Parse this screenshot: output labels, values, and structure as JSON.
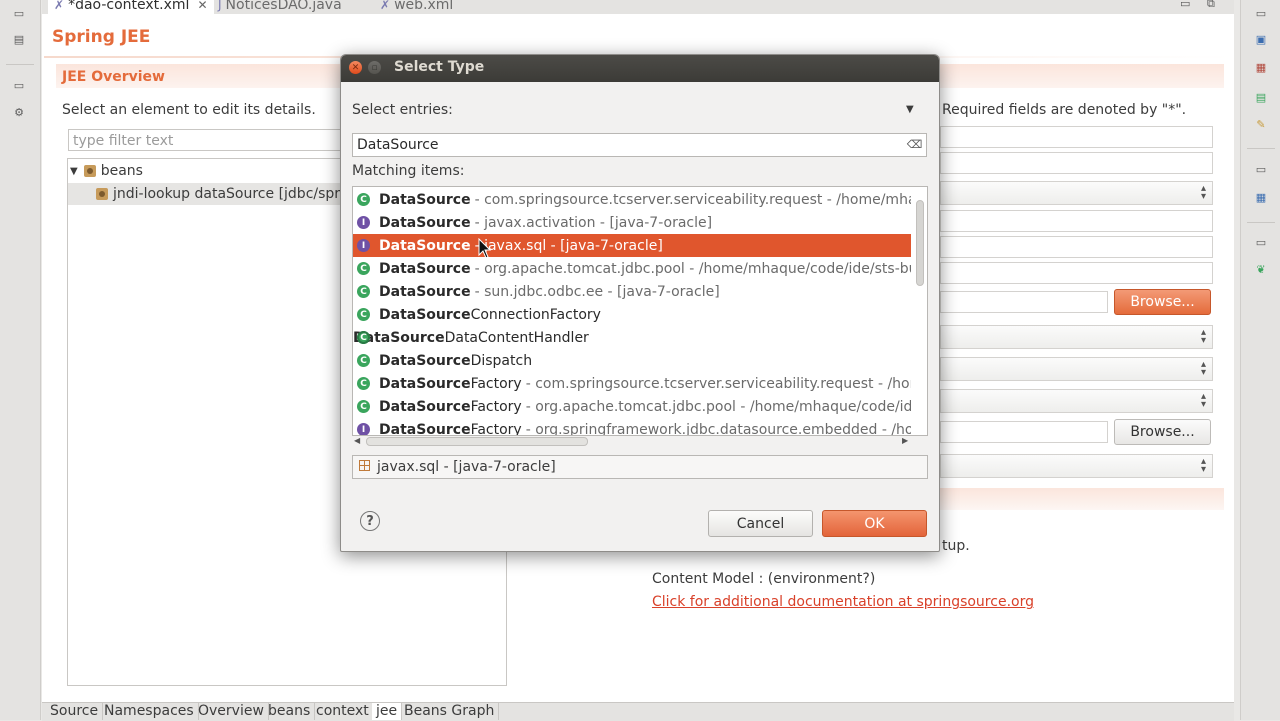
{
  "editor": {
    "tabs": [
      {
        "label": "*dao-context.xml"
      },
      {
        "label": "NoticesDAO.java"
      },
      {
        "label": "web.xml"
      }
    ],
    "form_title": "Spring JEE",
    "section_title": "JEE Overview",
    "section_desc": "Select an element to edit its details.",
    "filter_placeholder": "type filter text",
    "tree": {
      "root": "beans",
      "child": "jndi-lookup dataSource [jdbc/sprin"
    },
    "required_note": "Required fields are denoted by \"*\".",
    "browse_label": "Browse...",
    "doc_startup": "tup.",
    "doc_model": "Content Model : (environment?)",
    "doc_link": "Click for additional documentation at springsource.org",
    "bottom_tabs": [
      "Source",
      "Namespaces",
      "Overview",
      "beans",
      "context",
      "jee",
      "Beans Graph"
    ]
  },
  "dialog": {
    "title": "Select Type",
    "entries_label": "Select entries:",
    "search_value": "DataSource",
    "matching_label": "Matching items:",
    "items": [
      {
        "icon": "class",
        "prefix": "DataSource",
        "suffix": "",
        "pkg": "- com.springsource.tcserver.serviceability.request - /home/mhaque"
      },
      {
        "icon": "interface",
        "prefix": "DataSource",
        "suffix": "",
        "pkg": "- javax.activation - [java-7-oracle]"
      },
      {
        "icon": "interface",
        "prefix": "DataSource",
        "suffix": "",
        "pkg": "- javax.sql - [java-7-oracle]",
        "selected": true
      },
      {
        "icon": "class",
        "prefix": "DataSource",
        "suffix": "",
        "pkg": "- org.apache.tomcat.jdbc.pool - /home/mhaque/code/ide/sts-bund"
      },
      {
        "icon": "class",
        "prefix": "DataSource",
        "suffix": "",
        "pkg": "- sun.jdbc.odbc.ee - [java-7-oracle]"
      },
      {
        "icon": "class",
        "prefix": "DataSource",
        "suffix": "ConnectionFactory",
        "pkg": ""
      },
      {
        "icon": "abstract",
        "prefix": "DataSource",
        "suffix": "DataContentHandler",
        "pkg": ""
      },
      {
        "icon": "class",
        "prefix": "DataSource",
        "suffix": "Dispatch",
        "pkg": ""
      },
      {
        "icon": "class",
        "prefix": "DataSource",
        "suffix": "Factory",
        "pkg": "- com.springsource.tcserver.serviceability.request - /home/"
      },
      {
        "icon": "class",
        "prefix": "DataSource",
        "suffix": "Factory",
        "pkg": "- org.apache.tomcat.jdbc.pool - /home/mhaque/code/ide/s"
      },
      {
        "icon": "interface",
        "prefix": "DataSource",
        "suffix": "Factory",
        "pkg": "- org.springframework.jdbc.datasource.embedded - /home"
      }
    ],
    "package_value": "javax.sql - [java-7-oracle]",
    "cancel_label": "Cancel",
    "ok_label": "OK"
  },
  "colors": {
    "accent": "#e46b3b",
    "selection": "#e0562d",
    "link": "#d9412a",
    "titlebar": "#3c3b37"
  },
  "icons": {
    "class": "green-circle-c",
    "interface": "purple-circle-i",
    "abstract": "green-circle-c-abstract"
  }
}
